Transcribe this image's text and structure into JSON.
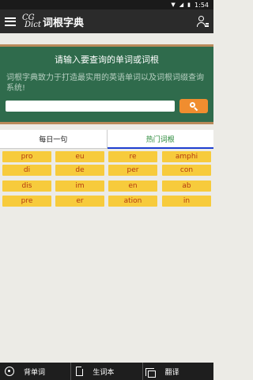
{
  "status_bar": {
    "time": "1:54"
  },
  "app_bar": {
    "logo_line1": "CG",
    "logo_line2": "Dict",
    "title": "词根字典"
  },
  "board": {
    "title": "请输入要查询的单词或词根",
    "description": "词根字典致力于打造最实用的英语单词以及词根词缀查询系统!",
    "search_value": "",
    "search_placeholder": ""
  },
  "tabs": [
    {
      "label": "每日一句",
      "active": false
    },
    {
      "label": "热门词根",
      "active": true
    }
  ],
  "roots": [
    [
      "pro",
      "eu",
      "re",
      "amphi"
    ],
    [
      "di",
      "de",
      "per",
      "con"
    ],
    [
      "dis",
      "im",
      "en",
      "ab"
    ],
    [
      "pre",
      "er",
      "ation",
      "in"
    ]
  ],
  "bottom_bar": [
    {
      "label": "背单词",
      "icon": "refresh-icon"
    },
    {
      "label": "生词本",
      "icon": "document-icon"
    },
    {
      "label": "翻译",
      "icon": "copy-icon"
    }
  ],
  "colors": {
    "board": "#2f6b4c",
    "chip": "#f7cb3c",
    "chip_text": "#b43a10",
    "accent": "#f08d2f",
    "active_tab": "#2a8a3a"
  }
}
